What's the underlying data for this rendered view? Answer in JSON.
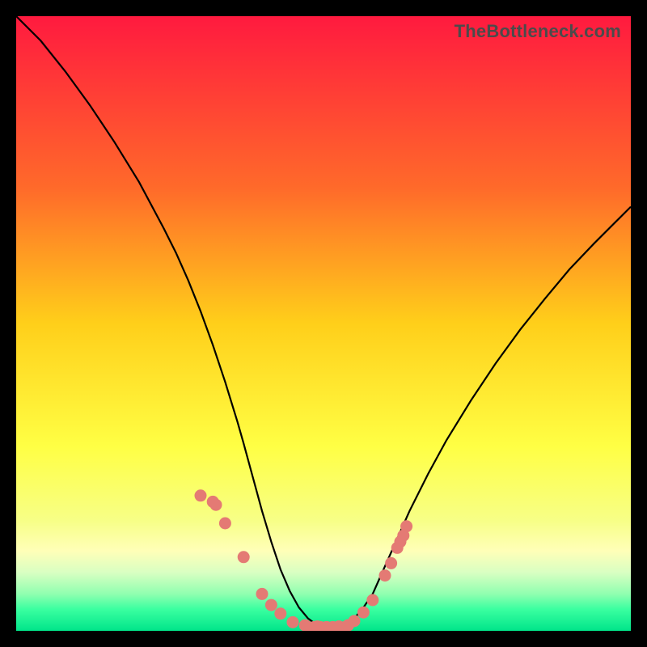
{
  "watermark": "TheBottleneck.com",
  "colors": {
    "frame": "#000000",
    "curve": "#000000",
    "markers": "#e47a74",
    "gradient_stops": [
      {
        "offset": 0.0,
        "color": "#ff1a3f"
      },
      {
        "offset": 0.28,
        "color": "#ff6a2a"
      },
      {
        "offset": 0.5,
        "color": "#ffcf1a"
      },
      {
        "offset": 0.7,
        "color": "#ffff44"
      },
      {
        "offset": 0.82,
        "color": "#f7ff86"
      },
      {
        "offset": 0.87,
        "color": "#ffffb8"
      },
      {
        "offset": 0.905,
        "color": "#d9ffc2"
      },
      {
        "offset": 0.94,
        "color": "#90ffb0"
      },
      {
        "offset": 0.965,
        "color": "#3affa0"
      },
      {
        "offset": 1.0,
        "color": "#00e58a"
      }
    ]
  },
  "chart_data": {
    "type": "line",
    "title": "",
    "xlabel": "",
    "ylabel": "",
    "xlim": [
      0,
      100
    ],
    "ylim": [
      0,
      100
    ],
    "x": [
      0,
      4,
      8,
      12,
      16,
      20,
      24,
      26,
      28,
      30,
      32,
      34,
      36,
      37,
      38.5,
      40,
      41.5,
      43,
      44.5,
      46,
      47.5,
      49,
      50.5,
      52,
      53.5,
      55,
      56.5,
      58,
      60,
      62,
      64,
      67,
      70,
      74,
      78,
      82,
      86,
      90,
      94,
      98,
      100
    ],
    "values": [
      100,
      96,
      91,
      85.5,
      79.5,
      73,
      65.5,
      61.5,
      57,
      52,
      46.5,
      40.5,
      34,
      30.5,
      25,
      19.5,
      14.5,
      10,
      6.5,
      3.8,
      2,
      0.9,
      0.4,
      0.4,
      0.9,
      2,
      3.8,
      6,
      10.5,
      15,
      19.5,
      25.5,
      31,
      37.5,
      43.5,
      49,
      54,
      58.8,
      63,
      67,
      69
    ],
    "markers": {
      "x": [
        30,
        32,
        32.5,
        34,
        37,
        40,
        41.5,
        43,
        45,
        47,
        49,
        50.5,
        52.5,
        54,
        55,
        56.5,
        58,
        60,
        61,
        62,
        62.5,
        63,
        63.5
      ],
      "y": [
        22,
        21,
        20.5,
        17.5,
        12,
        6,
        4.2,
        2.8,
        1.4,
        0.9,
        0.7,
        0.6,
        0.7,
        0.9,
        1.6,
        3.0,
        5.0,
        9.0,
        11.0,
        13.5,
        14.5,
        15.5,
        17.0
      ]
    },
    "bottom_cluster": {
      "x": [
        47.5,
        48.5,
        49.5,
        50.5,
        51.5,
        52.5,
        53.5
      ],
      "y": [
        0.55,
        0.55,
        0.55,
        0.55,
        0.55,
        0.55,
        0.55
      ]
    }
  }
}
